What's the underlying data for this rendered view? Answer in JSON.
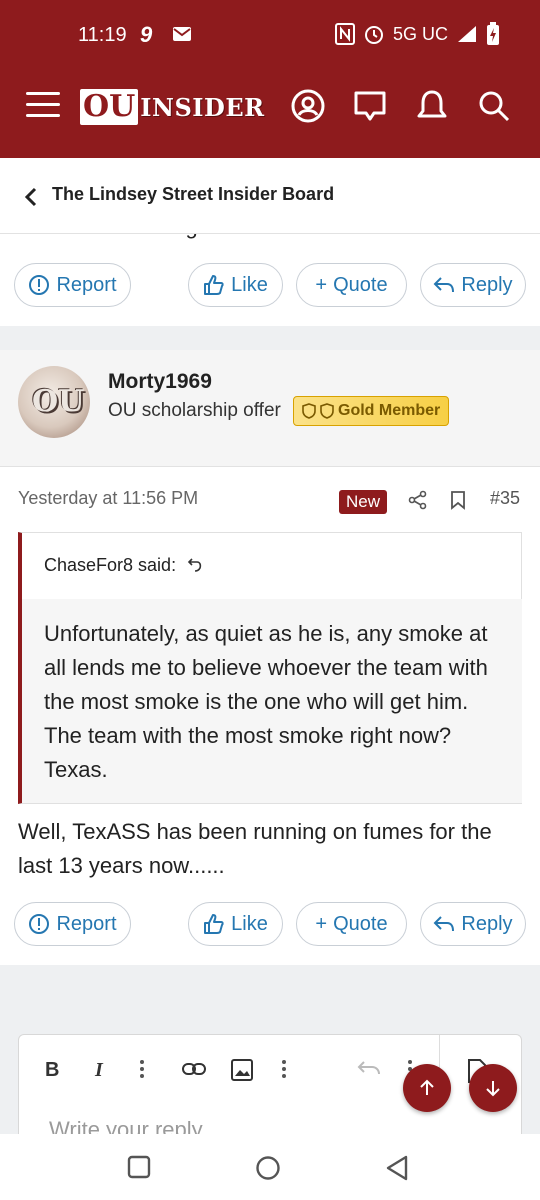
{
  "status_bar": {
    "time": "11:19",
    "network": "5G UC"
  },
  "app": {
    "logo_ou": "OU",
    "logo_insider": "INSIDER"
  },
  "breadcrumb": {
    "title": "The Lindsey Street Insider Board"
  },
  "prev_post": {
    "clipped_text": "So we are missing on stone."
  },
  "actions": {
    "report": "Report",
    "like": "Like",
    "quote": "Quote",
    "reply": "Reply"
  },
  "post": {
    "username": "Morty1969",
    "user_title": "OU scholarship offer",
    "badge": "Gold Member",
    "date": "Yesterday at 11:56 PM",
    "new_label": "New",
    "number": "#35",
    "quote_author": "ChaseFor8 said:",
    "quote_text": "Unfortunately, as quiet as he is, any smoke at all lends me to believe whoever the team with the most smoke is the one who will get him. The team with the most smoke right now? Texas.",
    "body": "Well, TexASS has been running on fumes for the last 13 years now......"
  },
  "editor": {
    "bold": "B",
    "italic": "I",
    "placeholder": "Write your reply..."
  },
  "colors": {
    "brand": "#8e1b1d",
    "link": "#2577b1",
    "gold": "#f7cf45"
  }
}
